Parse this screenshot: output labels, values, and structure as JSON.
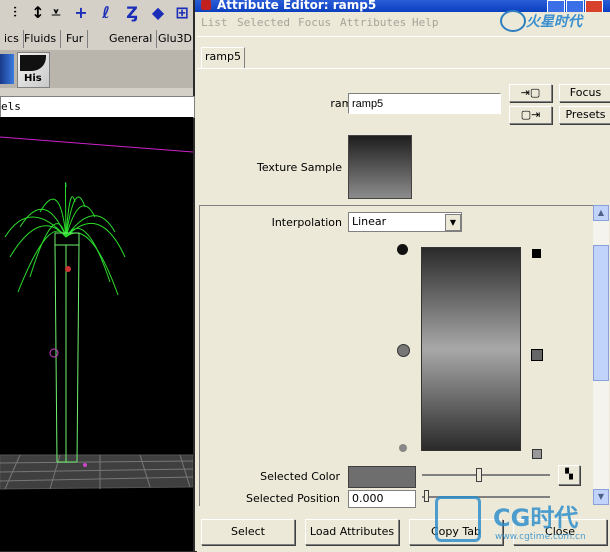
{
  "maya": {
    "shelf_tabs": [
      "ics",
      "Fluids",
      "Fur",
      "General",
      "Glu3D"
    ],
    "shelf_his_label": "His",
    "panel_label": "els"
  },
  "ae": {
    "title": "Attribute Editor: ramp5",
    "menu": [
      "List",
      "Selected",
      "Focus",
      "Attributes",
      "Help"
    ],
    "node_tab": "ramp5",
    "ramp_label": "ramp:",
    "ramp_value": "ramp5",
    "focus_button": "Focus",
    "presets_button": "Presets",
    "texture_sample_label": "Texture Sample",
    "interpolation_label": "Interpolation",
    "interpolation_value": "Linear",
    "selected_color_label": "Selected Color",
    "selected_position_label": "Selected Position",
    "selected_position_value": "0.000",
    "bottom_buttons": [
      "Select",
      "Load Attributes",
      "Copy Tab",
      "Close"
    ]
  },
  "watermark": {
    "top_brand": "火星时代",
    "bottom_brand": "CG时代",
    "bottom_url": "www.cgtime.com.cn"
  },
  "colors": {
    "ae_bg": "#ece9d8",
    "title_blue": "#0a3fc0",
    "viewport_bg": "#000000",
    "fountain_green": "#2bdc2b",
    "ramp_dark": "#2a2a2a",
    "ramp_light": "#a8a8a8"
  }
}
